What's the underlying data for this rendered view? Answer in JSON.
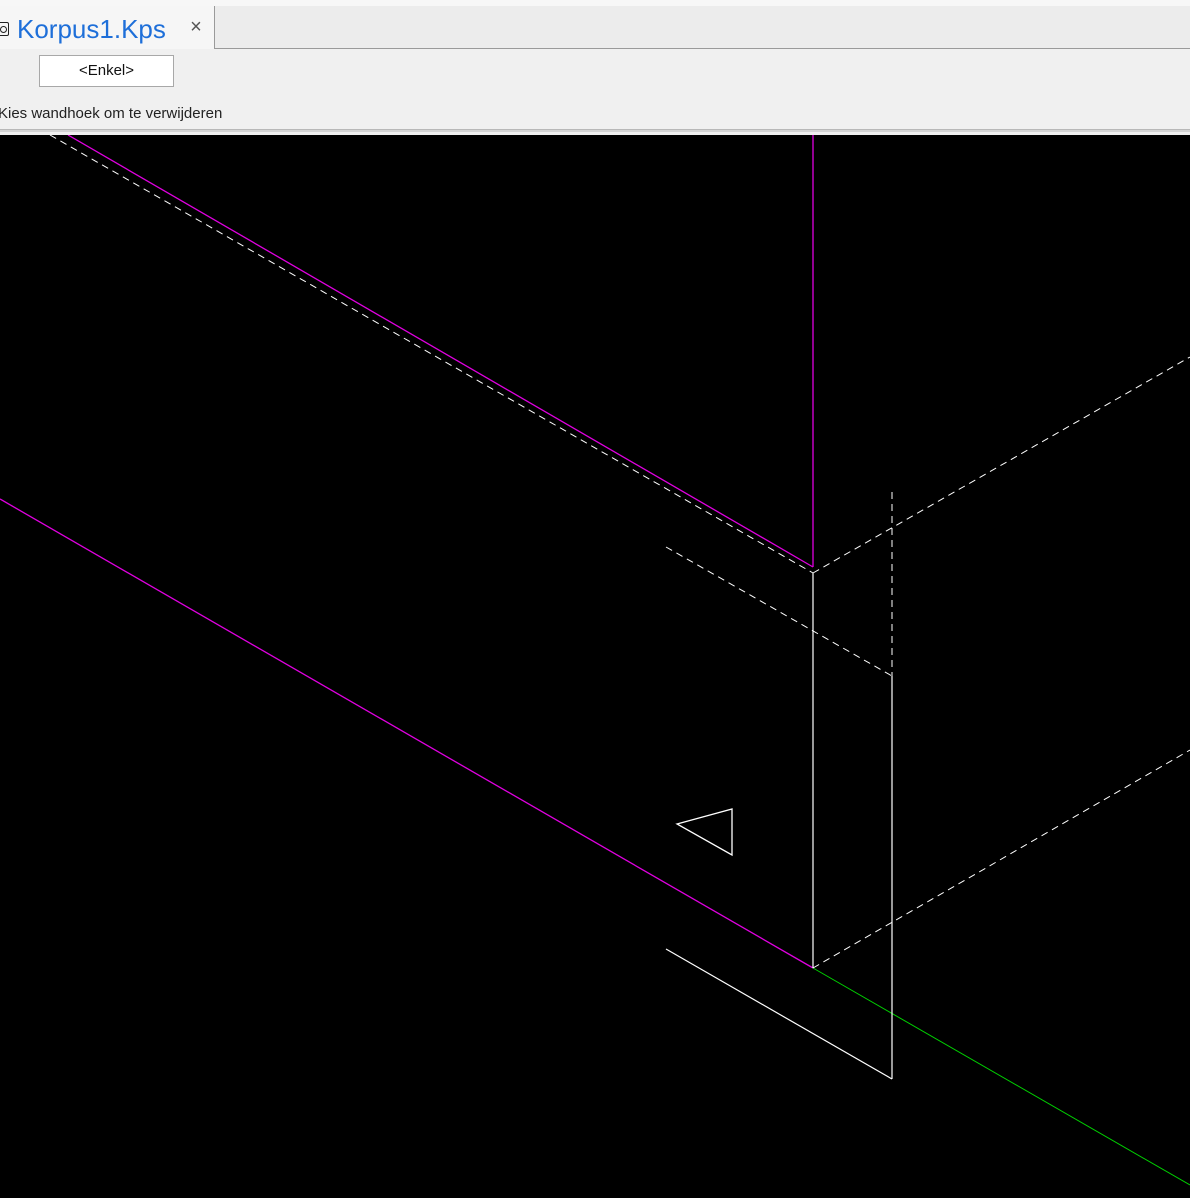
{
  "tab": {
    "title": "Korpus1.Kps",
    "close_glyph": "×",
    "icon": "document-icon"
  },
  "toolbar": {
    "mode_button_label": "<Enkel>",
    "prompt_text": "Kies wandhoek om te verwijderen"
  },
  "viewport": {
    "background": "#000000",
    "colors": {
      "magenta": "#e000e0",
      "white": "#ffffff",
      "green": "#00d000"
    }
  }
}
